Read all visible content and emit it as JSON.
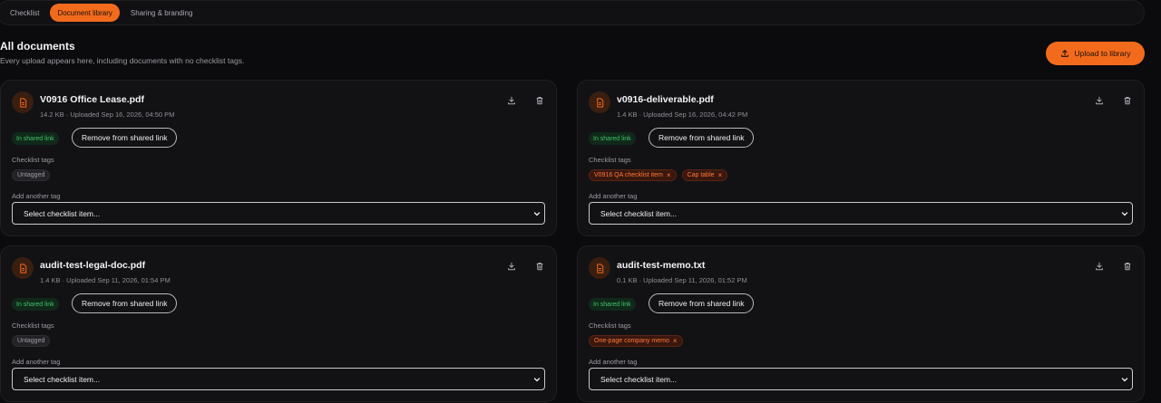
{
  "tabs": [
    {
      "label": "Checklist",
      "active": false
    },
    {
      "label": "Document library",
      "active": true
    },
    {
      "label": "Sharing & branding",
      "active": false
    }
  ],
  "section": {
    "title": "All documents",
    "subtitle": "Every upload appears here, including documents with no checklist tags."
  },
  "upload_button": {
    "label": "Upload to library",
    "icon": "upload-icon"
  },
  "labels": {
    "shared": "In shared link",
    "remove": "Remove from shared link",
    "checklist_tags": "Checklist tags",
    "add_tag": "Add another tag",
    "select_placeholder": "Select checklist item...",
    "untagged": "Untagged"
  },
  "documents": [
    {
      "name": "V0916 Office Lease.pdf",
      "meta": "14.2 KB · Uploaded Sep 16, 2026, 04:50 PM",
      "tags": []
    },
    {
      "name": "v0916-deliverable.pdf",
      "meta": "1.4 KB · Uploaded Sep 16, 2026, 04:42 PM",
      "tags": [
        "V0916 QA checklist item",
        "Cap table"
      ]
    },
    {
      "name": "audit-test-legal-doc.pdf",
      "meta": "1.4 KB · Uploaded Sep 11, 2026, 01:54 PM",
      "tags": []
    },
    {
      "name": "audit-test-memo.txt",
      "meta": "0.1 KB · Uploaded Sep 11, 2026, 01:52 PM",
      "tags": [
        "One-page company memo"
      ]
    }
  ],
  "colors": {
    "accent": "#f26b1d",
    "shared_green": "#41c56a",
    "background": "#0b0b0d",
    "card": "#121215"
  }
}
